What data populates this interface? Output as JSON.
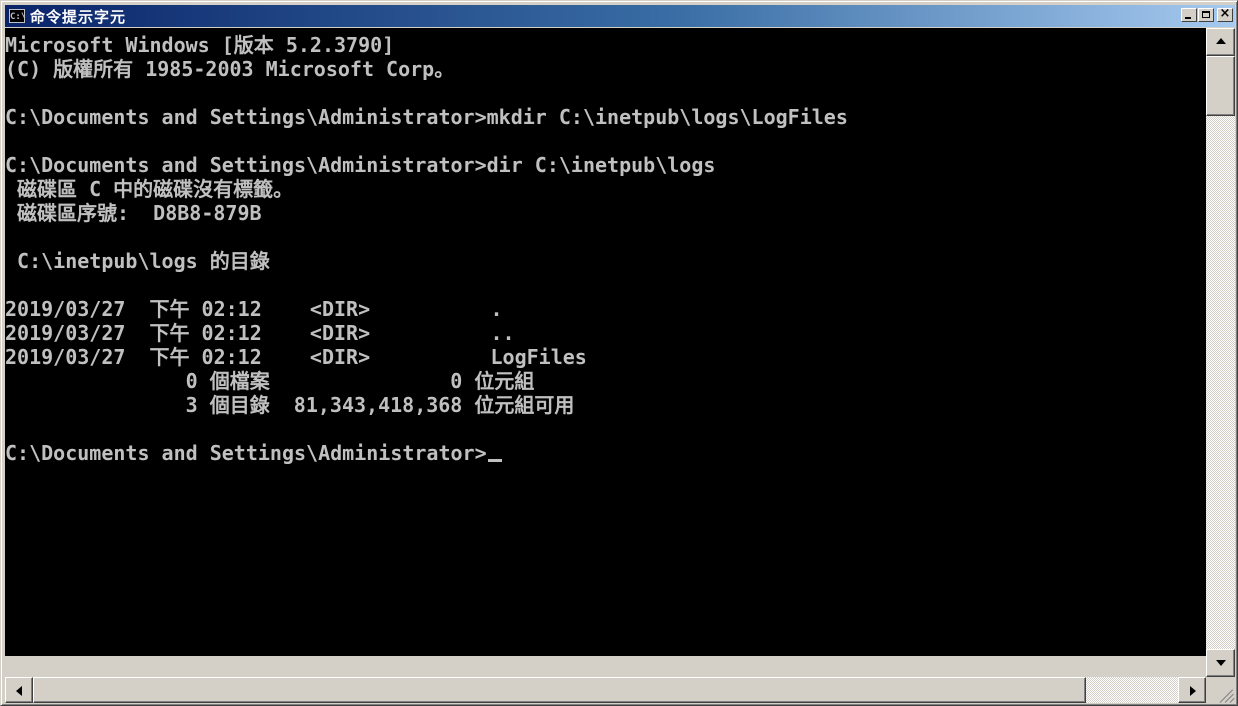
{
  "window": {
    "title": "命令提示字元",
    "icon_label": "C:\\",
    "icon": "console-icon"
  },
  "title_buttons": {
    "minimize": "minimize-icon",
    "maximize": "maximize-icon",
    "close": "close-icon",
    "close_glyph": "×"
  },
  "console": {
    "lines": [
      "Microsoft Windows [版本 5.2.3790]",
      "(C) 版權所有 1985-2003 Microsoft Corp。",
      "",
      "C:\\Documents and Settings\\Administrator>mkdir C:\\inetpub\\logs\\LogFiles",
      "",
      "C:\\Documents and Settings\\Administrator>dir C:\\inetpub\\logs",
      " 磁碟區 C 中的磁碟沒有標籤。",
      " 磁碟區序號:  D8B8-879B",
      "",
      " C:\\inetpub\\logs 的目錄",
      "",
      "2019/03/27  下午 02:12    <DIR>          .",
      "2019/03/27  下午 02:12    <DIR>          ..",
      "2019/03/27  下午 02:12    <DIR>          LogFiles",
      "               0 個檔案               0 位元組",
      "               3 個目錄  81,343,418,368 位元組可用",
      ""
    ],
    "prompt": "C:\\Documents and Settings\\Administrator>"
  },
  "colors": {
    "console_background": "#000000",
    "console_text": "#c0c0c0",
    "titlebar_start": "#0a246a",
    "titlebar_end": "#a6caf0"
  }
}
